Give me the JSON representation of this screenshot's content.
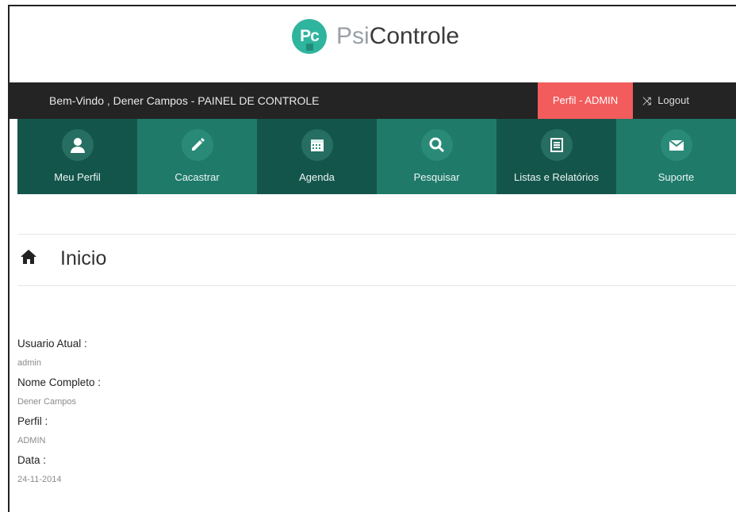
{
  "brand": {
    "badge": "Pc",
    "name_light": "Psi",
    "name_strong": "Controle"
  },
  "topbar": {
    "welcome": "Bem-Vindo , Dener  Campos - PAINEL DE CONTROLE",
    "profile_badge": "Perfil - ADMIN",
    "logout_label": "Logout",
    "logout_icon": "shuffle-icon"
  },
  "nav": [
    {
      "label": "Meu Perfil",
      "icon": "user-icon"
    },
    {
      "label": "Cacastrar",
      "icon": "pencil-icon"
    },
    {
      "label": "Agenda",
      "icon": "calendar-icon"
    },
    {
      "label": "Pesquisar",
      "icon": "search-icon"
    },
    {
      "label": "Listas e Relatórios",
      "icon": "list-icon"
    },
    {
      "label": "Suporte",
      "icon": "envelope-icon"
    }
  ],
  "page": {
    "title": "Inicio",
    "icon": "home-icon"
  },
  "info": {
    "user_label": "Usuario Atual :",
    "user_value": "admin",
    "name_label": "Nome Completo :",
    "name_value": "Dener Campos",
    "profile_label": "Perfil :",
    "profile_value": "ADMIN",
    "date_label": "Data :",
    "date_value": "24-11-2014"
  },
  "colors": {
    "brand": "#2fb59e",
    "nav_dark": "#14554b",
    "nav_light": "#1f7a6a",
    "topbar": "#242424",
    "profile_badge": "#f25c5c"
  }
}
